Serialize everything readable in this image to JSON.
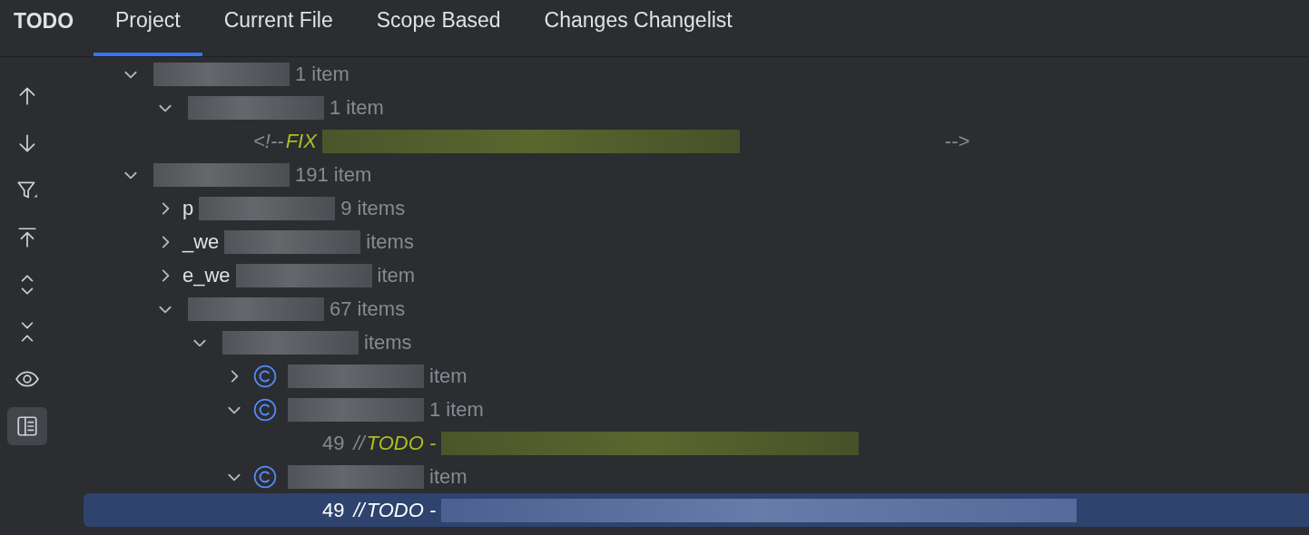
{
  "title": "TODO",
  "tabs": [
    {
      "label": "Project",
      "selected": true
    },
    {
      "label": "Current File",
      "selected": false
    },
    {
      "label": "Scope Based",
      "selected": false
    },
    {
      "label": "Changes Changelist",
      "selected": false
    }
  ],
  "toolbar": [
    {
      "kind": "up",
      "selected": false
    },
    {
      "kind": "down",
      "selected": false
    },
    {
      "kind": "filter",
      "selected": false
    },
    {
      "kind": "export",
      "selected": false
    },
    {
      "kind": "expand",
      "selected": false
    },
    {
      "kind": "collapse",
      "selected": false
    },
    {
      "kind": "eye",
      "selected": false
    },
    {
      "kind": "preview",
      "selected": true
    }
  ],
  "tree": [
    {
      "kind": "node",
      "count": "1 item",
      "expanded": true,
      "children": [
        {
          "kind": "node",
          "count": "1 item",
          "expanded": true,
          "children": [
            {
              "kind": "todo",
              "prefix": "<!--",
              "keyword": "FIX",
              "suffix": "-->",
              "selected": false
            }
          ]
        }
      ]
    },
    {
      "kind": "node",
      "count": "191 item",
      "expanded": true,
      "children": [
        {
          "kind": "node",
          "label": "p",
          "count": "9 items",
          "expanded": false
        },
        {
          "kind": "node",
          "label": "_we",
          "count": "items",
          "expanded": false
        },
        {
          "kind": "node",
          "label": "e_we",
          "count": "item",
          "expanded": false
        },
        {
          "kind": "node",
          "count": "67 items",
          "expanded": true,
          "children": [
            {
              "kind": "node",
              "count": "items",
              "expanded": true,
              "children": [
                {
                  "kind": "class",
                  "count": "item",
                  "expanded": false
                },
                {
                  "kind": "class",
                  "count": "1 item",
                  "expanded": true,
                  "children": [
                    {
                      "kind": "todo",
                      "line": "49",
                      "prefix": "//",
                      "keyword": "TODO -",
                      "selected": false
                    }
                  ]
                },
                {
                  "kind": "class",
                  "count": "item",
                  "expanded": true,
                  "children": [
                    {
                      "kind": "todo",
                      "line": "49",
                      "prefix": "//",
                      "keyword": "TODO -",
                      "selected": true
                    }
                  ]
                }
              ]
            }
          ]
        }
      ]
    }
  ]
}
